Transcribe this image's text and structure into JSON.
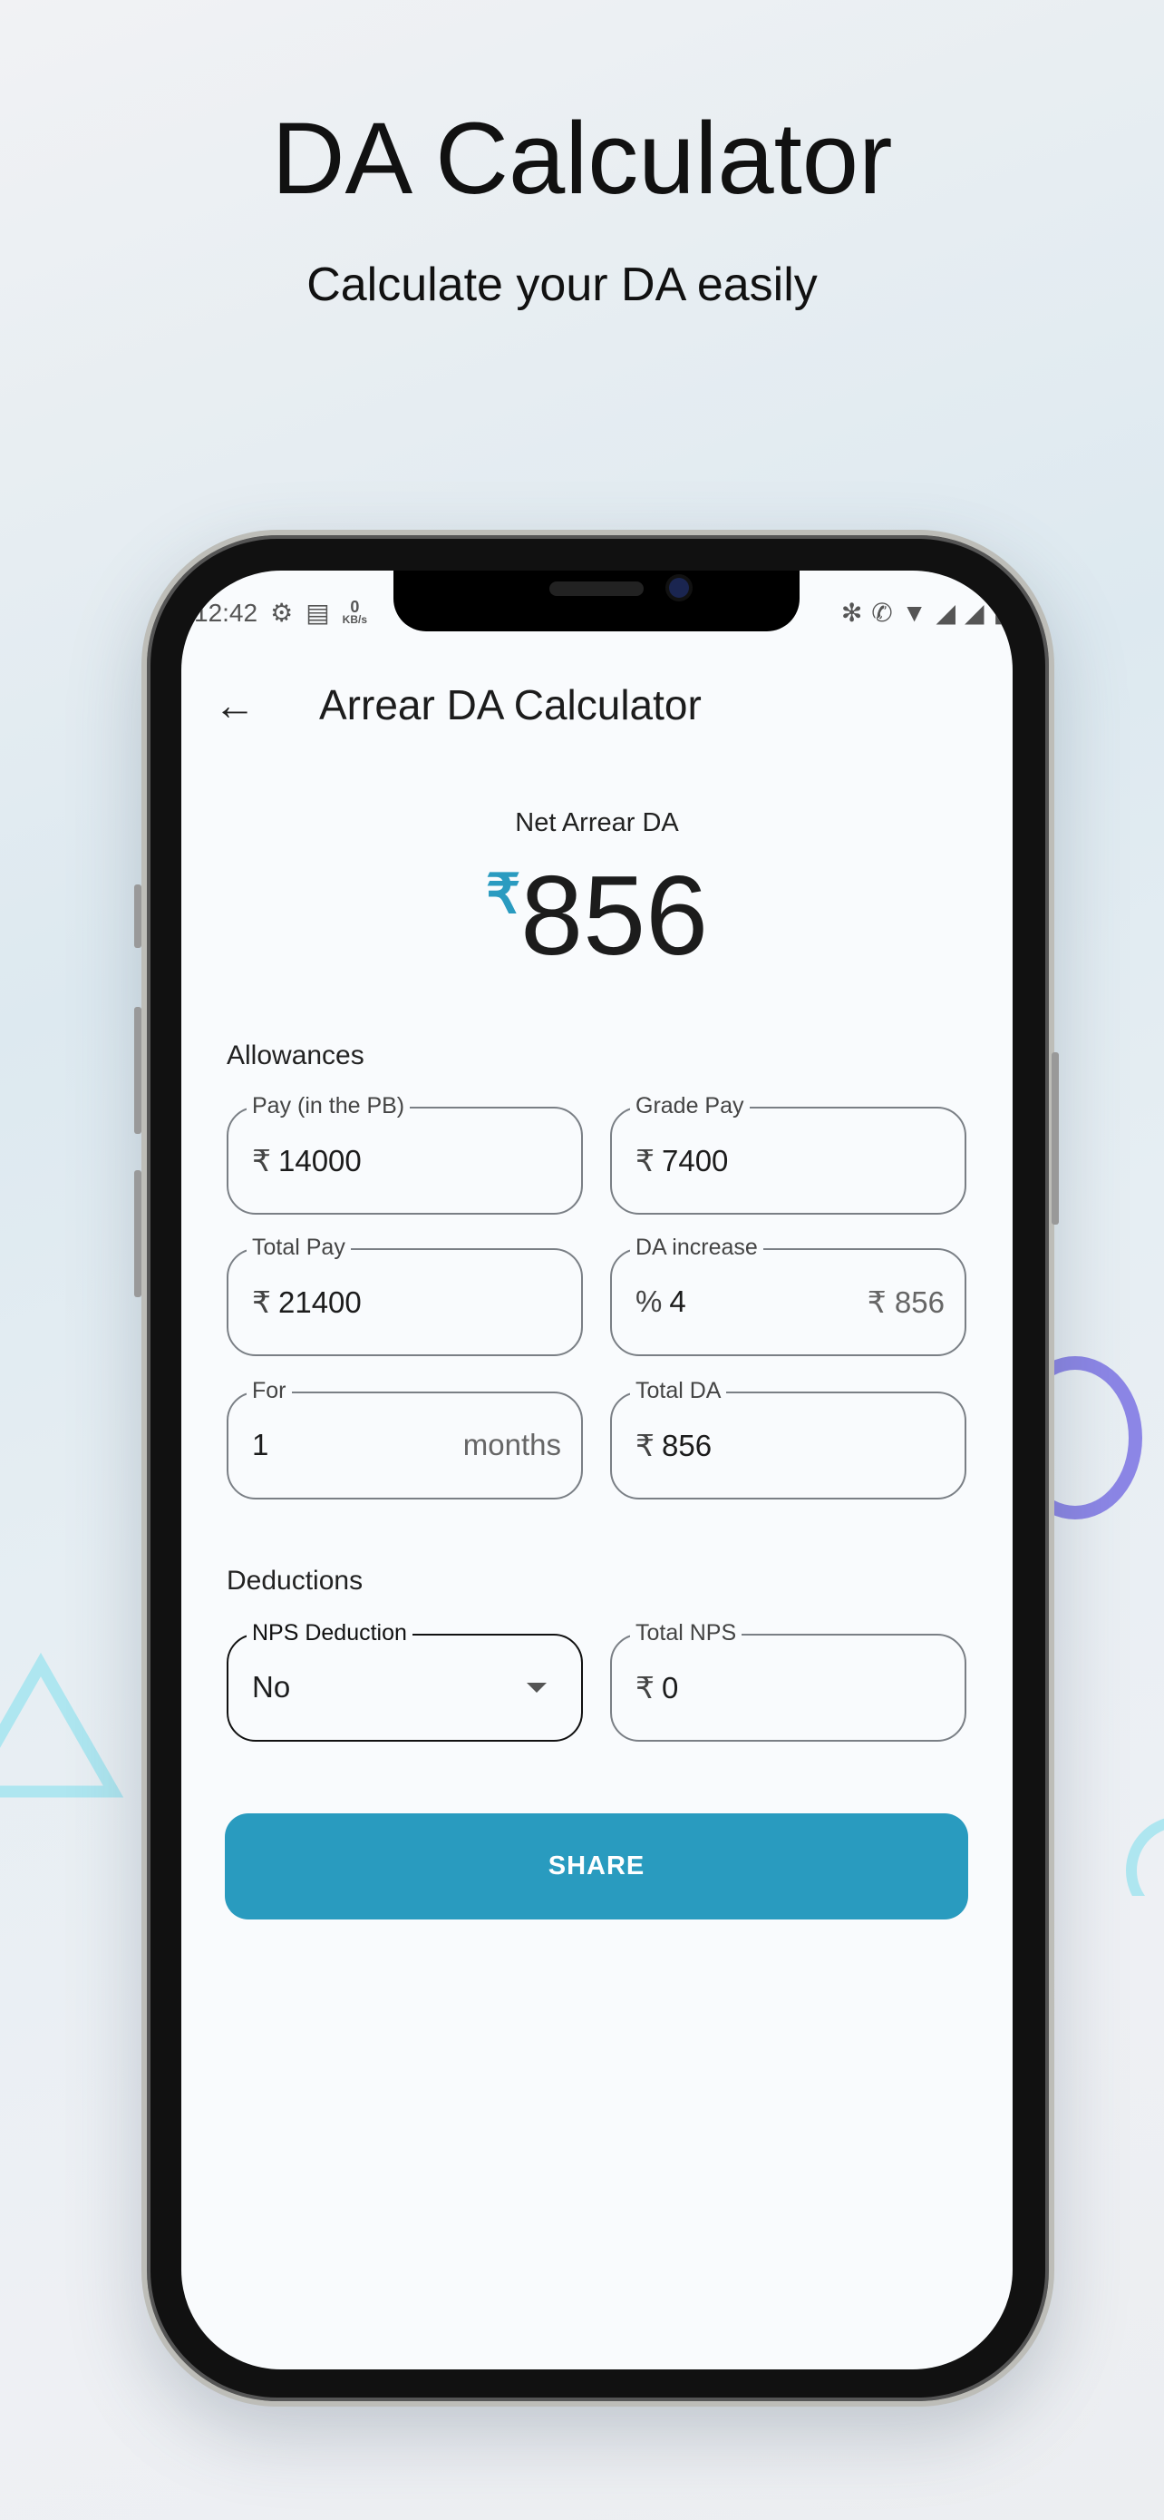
{
  "hero": {
    "title": "DA Calculator",
    "subtitle": "Calculate your DA easily"
  },
  "status_bar": {
    "time": "12:42",
    "net_speed_value": "0",
    "net_speed_unit": "KB/s"
  },
  "app_bar": {
    "title": "Arrear DA Calculator",
    "back_icon": "arrow-left-icon"
  },
  "summary": {
    "label": "Net Arrear DA",
    "currency": "₹",
    "value": "856"
  },
  "allowances": {
    "heading": "Allowances",
    "pay": {
      "label": "Pay (in the PB)",
      "prefix": "₹",
      "value": "14000"
    },
    "grade_pay": {
      "label": "Grade Pay",
      "prefix": "₹",
      "value": "7400"
    },
    "total_pay": {
      "label": "Total Pay",
      "prefix": "₹",
      "value": "21400"
    },
    "da_increase": {
      "label": "DA increase",
      "prefix": "%",
      "value": "4",
      "suffix": "₹ 856"
    },
    "for": {
      "label": "For",
      "value": "1",
      "suffix": "months"
    },
    "total_da": {
      "label": "Total DA",
      "prefix": "₹",
      "value": "856"
    }
  },
  "deductions": {
    "heading": "Deductions",
    "nps_deduction": {
      "label": "NPS Deduction",
      "value": "No"
    },
    "total_nps": {
      "label": "Total NPS",
      "prefix": "₹",
      "value": "0"
    }
  },
  "share_label": "SHARE",
  "colors": {
    "accent": "#299bbf",
    "ring": "#8c86e6",
    "triangle": "#aee6f0"
  }
}
